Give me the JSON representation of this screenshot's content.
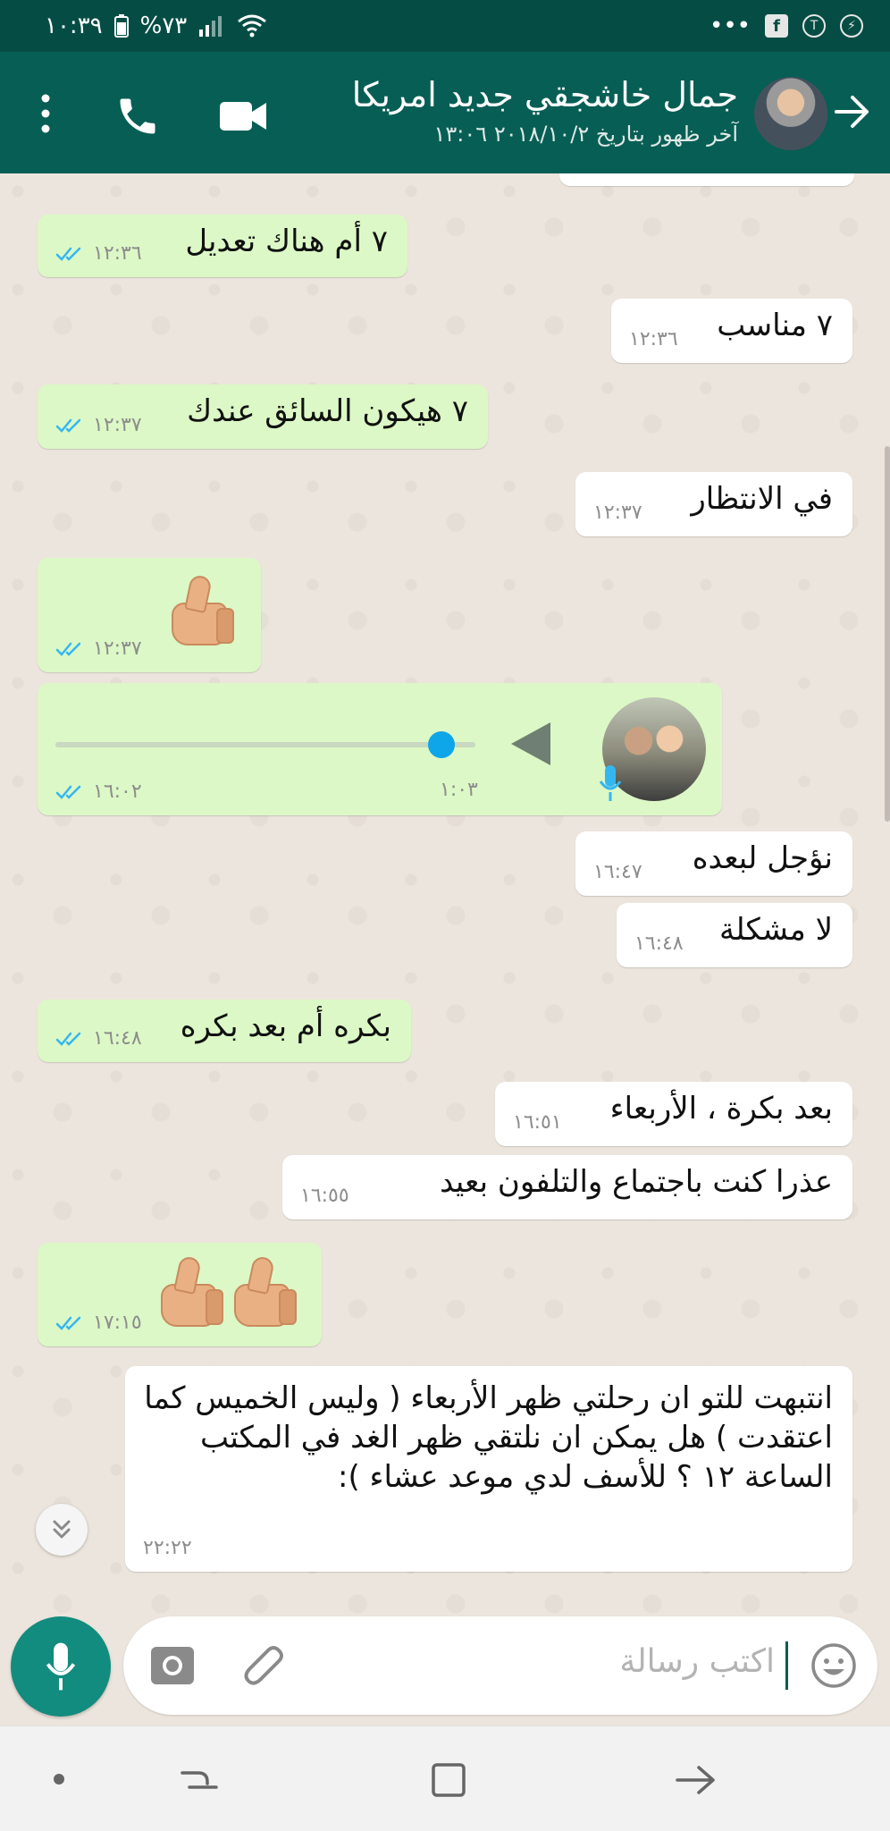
{
  "status_bar": {
    "time": "١٠:٣٩",
    "battery": "%٧٣",
    "dots": "•••",
    "app_icons": [
      "facebook-icon",
      "tamtam-icon",
      "messenger-icon"
    ]
  },
  "header": {
    "contact_name": "جمال خاشجقي جديد امريكا",
    "last_seen": "آخر ظهور بتاريخ ٢٠١٨/١٠/٢ ١٣:٠٦",
    "icons": [
      "back-arrow-icon",
      "phone-icon",
      "video-camera-icon",
      "more-vert-icon"
    ]
  },
  "messages": [
    {
      "side": "out",
      "text": "٧ أم هناك تعديل",
      "time": "١٢:٣٦"
    },
    {
      "side": "in",
      "text": "٧ مناسب",
      "time": "١٢:٣٦"
    },
    {
      "side": "out",
      "text": "٧ هيكون السائق عندك",
      "time": "١٢:٣٧"
    },
    {
      "side": "in",
      "text": "في الانتظار",
      "time": "١٢:٣٧"
    },
    {
      "side": "out",
      "text": "👍🏼",
      "time": "١٢:٣٧"
    },
    {
      "side": "out",
      "type": "voice",
      "duration": "١:٠٣",
      "time": "١٦:٠٢",
      "progress": 0.92
    },
    {
      "side": "in",
      "text": "نؤجل لبعده",
      "time": "١٦:٤٧"
    },
    {
      "side": "in",
      "text": "لا مشكلة",
      "time": "١٦:٤٨"
    },
    {
      "side": "out",
      "text": "بكره أم بعد بكره",
      "time": "١٦:٤٨"
    },
    {
      "side": "in",
      "text": "بعد بكرة ، الأربعاء",
      "time": "١٦:٥١"
    },
    {
      "side": "in",
      "text": "عذرا كنت باجتماع والتلفون بعيد",
      "time": "١٦:٥٥"
    },
    {
      "side": "out",
      "text": "👍🏼👍🏼",
      "time": "١٧:١٥"
    },
    {
      "side": "in",
      "text": "انتبهت للتو ان رحلتي ظهر الأربعاء ( وليس الخميس كما اعتقدت ) هل يمكن ان نلتقي ظهر الغد في المكتب الساعة ١٢ ؟ للأسف لدي موعد عشاء ):",
      "time": "٢٢:٢٢"
    }
  ],
  "input": {
    "placeholder": "اكتب رسالة"
  },
  "colors": {
    "header": "#075e54",
    "status_bar": "#054d44",
    "outgoing_bubble": "#dcf8c6",
    "incoming_bubble": "#ffffff",
    "tick_blue": "#34b7f1",
    "mic_button": "#128c7e",
    "chat_bg": "#ece5dd"
  }
}
